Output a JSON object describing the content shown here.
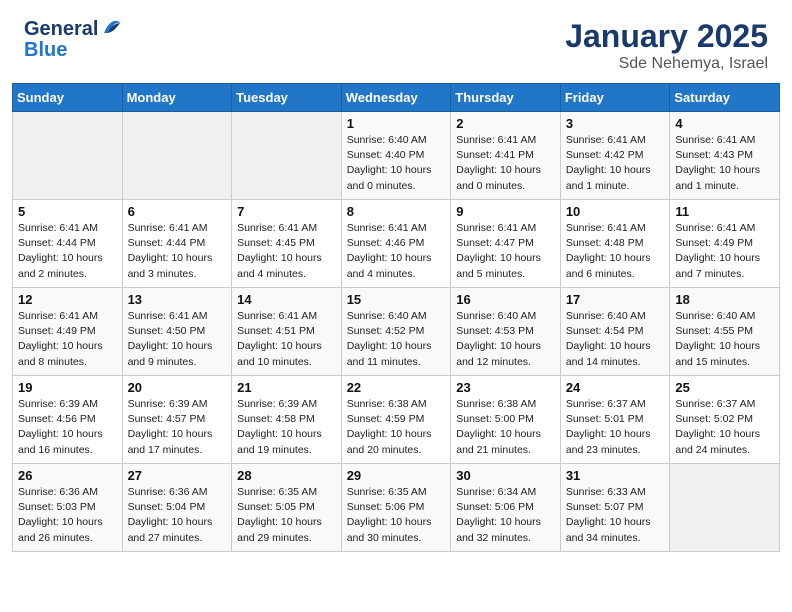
{
  "header": {
    "logo_general": "General",
    "logo_blue": "Blue",
    "title": "January 2025",
    "subtitle": "Sde Nehemya, Israel"
  },
  "days_of_week": [
    "Sunday",
    "Monday",
    "Tuesday",
    "Wednesday",
    "Thursday",
    "Friday",
    "Saturday"
  ],
  "weeks": [
    [
      {
        "day": "",
        "info": ""
      },
      {
        "day": "",
        "info": ""
      },
      {
        "day": "",
        "info": ""
      },
      {
        "day": "1",
        "info": "Sunrise: 6:40 AM\nSunset: 4:40 PM\nDaylight: 10 hours\nand 0 minutes."
      },
      {
        "day": "2",
        "info": "Sunrise: 6:41 AM\nSunset: 4:41 PM\nDaylight: 10 hours\nand 0 minutes."
      },
      {
        "day": "3",
        "info": "Sunrise: 6:41 AM\nSunset: 4:42 PM\nDaylight: 10 hours\nand 1 minute."
      },
      {
        "day": "4",
        "info": "Sunrise: 6:41 AM\nSunset: 4:43 PM\nDaylight: 10 hours\nand 1 minute."
      }
    ],
    [
      {
        "day": "5",
        "info": "Sunrise: 6:41 AM\nSunset: 4:44 PM\nDaylight: 10 hours\nand 2 minutes."
      },
      {
        "day": "6",
        "info": "Sunrise: 6:41 AM\nSunset: 4:44 PM\nDaylight: 10 hours\nand 3 minutes."
      },
      {
        "day": "7",
        "info": "Sunrise: 6:41 AM\nSunset: 4:45 PM\nDaylight: 10 hours\nand 4 minutes."
      },
      {
        "day": "8",
        "info": "Sunrise: 6:41 AM\nSunset: 4:46 PM\nDaylight: 10 hours\nand 4 minutes."
      },
      {
        "day": "9",
        "info": "Sunrise: 6:41 AM\nSunset: 4:47 PM\nDaylight: 10 hours\nand 5 minutes."
      },
      {
        "day": "10",
        "info": "Sunrise: 6:41 AM\nSunset: 4:48 PM\nDaylight: 10 hours\nand 6 minutes."
      },
      {
        "day": "11",
        "info": "Sunrise: 6:41 AM\nSunset: 4:49 PM\nDaylight: 10 hours\nand 7 minutes."
      }
    ],
    [
      {
        "day": "12",
        "info": "Sunrise: 6:41 AM\nSunset: 4:49 PM\nDaylight: 10 hours\nand 8 minutes."
      },
      {
        "day": "13",
        "info": "Sunrise: 6:41 AM\nSunset: 4:50 PM\nDaylight: 10 hours\nand 9 minutes."
      },
      {
        "day": "14",
        "info": "Sunrise: 6:41 AM\nSunset: 4:51 PM\nDaylight: 10 hours\nand 10 minutes."
      },
      {
        "day": "15",
        "info": "Sunrise: 6:40 AM\nSunset: 4:52 PM\nDaylight: 10 hours\nand 11 minutes."
      },
      {
        "day": "16",
        "info": "Sunrise: 6:40 AM\nSunset: 4:53 PM\nDaylight: 10 hours\nand 12 minutes."
      },
      {
        "day": "17",
        "info": "Sunrise: 6:40 AM\nSunset: 4:54 PM\nDaylight: 10 hours\nand 14 minutes."
      },
      {
        "day": "18",
        "info": "Sunrise: 6:40 AM\nSunset: 4:55 PM\nDaylight: 10 hours\nand 15 minutes."
      }
    ],
    [
      {
        "day": "19",
        "info": "Sunrise: 6:39 AM\nSunset: 4:56 PM\nDaylight: 10 hours\nand 16 minutes."
      },
      {
        "day": "20",
        "info": "Sunrise: 6:39 AM\nSunset: 4:57 PM\nDaylight: 10 hours\nand 17 minutes."
      },
      {
        "day": "21",
        "info": "Sunrise: 6:39 AM\nSunset: 4:58 PM\nDaylight: 10 hours\nand 19 minutes."
      },
      {
        "day": "22",
        "info": "Sunrise: 6:38 AM\nSunset: 4:59 PM\nDaylight: 10 hours\nand 20 minutes."
      },
      {
        "day": "23",
        "info": "Sunrise: 6:38 AM\nSunset: 5:00 PM\nDaylight: 10 hours\nand 21 minutes."
      },
      {
        "day": "24",
        "info": "Sunrise: 6:37 AM\nSunset: 5:01 PM\nDaylight: 10 hours\nand 23 minutes."
      },
      {
        "day": "25",
        "info": "Sunrise: 6:37 AM\nSunset: 5:02 PM\nDaylight: 10 hours\nand 24 minutes."
      }
    ],
    [
      {
        "day": "26",
        "info": "Sunrise: 6:36 AM\nSunset: 5:03 PM\nDaylight: 10 hours\nand 26 minutes."
      },
      {
        "day": "27",
        "info": "Sunrise: 6:36 AM\nSunset: 5:04 PM\nDaylight: 10 hours\nand 27 minutes."
      },
      {
        "day": "28",
        "info": "Sunrise: 6:35 AM\nSunset: 5:05 PM\nDaylight: 10 hours\nand 29 minutes."
      },
      {
        "day": "29",
        "info": "Sunrise: 6:35 AM\nSunset: 5:06 PM\nDaylight: 10 hours\nand 30 minutes."
      },
      {
        "day": "30",
        "info": "Sunrise: 6:34 AM\nSunset: 5:06 PM\nDaylight: 10 hours\nand 32 minutes."
      },
      {
        "day": "31",
        "info": "Sunrise: 6:33 AM\nSunset: 5:07 PM\nDaylight: 10 hours\nand 34 minutes."
      },
      {
        "day": "",
        "info": ""
      }
    ]
  ]
}
